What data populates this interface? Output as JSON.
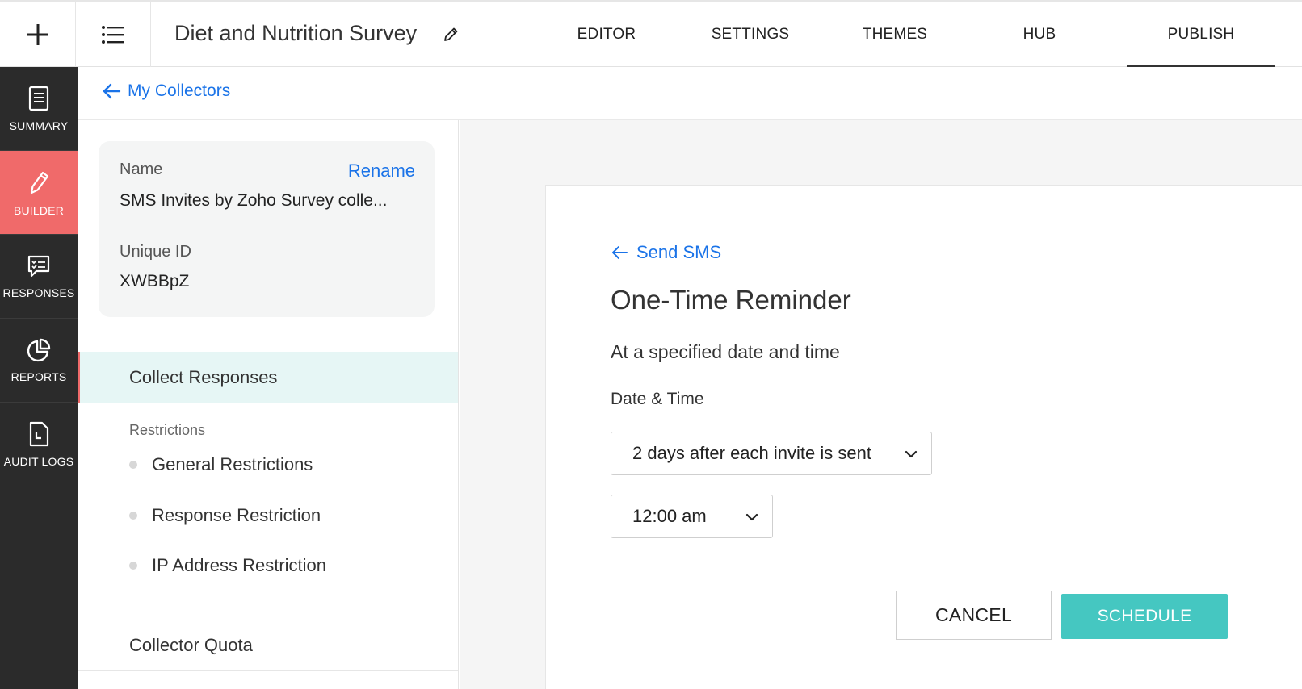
{
  "header": {
    "survey_title": "Diet and Nutrition Survey",
    "nav": [
      "EDITOR",
      "SETTINGS",
      "THEMES",
      "HUB",
      "PUBLISH"
    ],
    "active_nav": "PUBLISH"
  },
  "sidebar": {
    "items": [
      {
        "label": "SUMMARY",
        "icon": "document-icon"
      },
      {
        "label": "BUILDER",
        "icon": "pencil-icon",
        "active": true
      },
      {
        "label": "RESPONSES",
        "icon": "responses-icon"
      },
      {
        "label": "REPORTS",
        "icon": "pie-chart-icon"
      },
      {
        "label": "AUDIT LOGS",
        "icon": "audit-log-icon"
      }
    ],
    "active_color": "#f06a6a",
    "bg_color": "#2b2b2b"
  },
  "breadcrumb": {
    "back_label": "My Collectors"
  },
  "collector": {
    "name_label": "Name",
    "rename_label": "Rename",
    "name_value": "SMS Invites by Zoho Survey colle...",
    "id_label": "Unique ID",
    "id_value": "XWBBpZ"
  },
  "panel": {
    "collect_responses": "Collect Responses",
    "restrictions_heading": "Restrictions",
    "restrictions": [
      "General Restrictions",
      "Response Restriction",
      "IP Address Restriction"
    ],
    "collector_quota": "Collector Quota"
  },
  "reminder": {
    "back_label": "Send SMS",
    "title": "One-Time Reminder",
    "description": "At a specified date and time",
    "datetime_label": "Date & Time",
    "date_select": "2 days after each invite is sent",
    "time_select": "12:00 am",
    "cancel_label": "CANCEL",
    "schedule_label": "SCHEDULE"
  },
  "colors": {
    "link": "#1a73e8",
    "primary_button": "#45c7c1",
    "selected_row": "#e6f6f5"
  }
}
